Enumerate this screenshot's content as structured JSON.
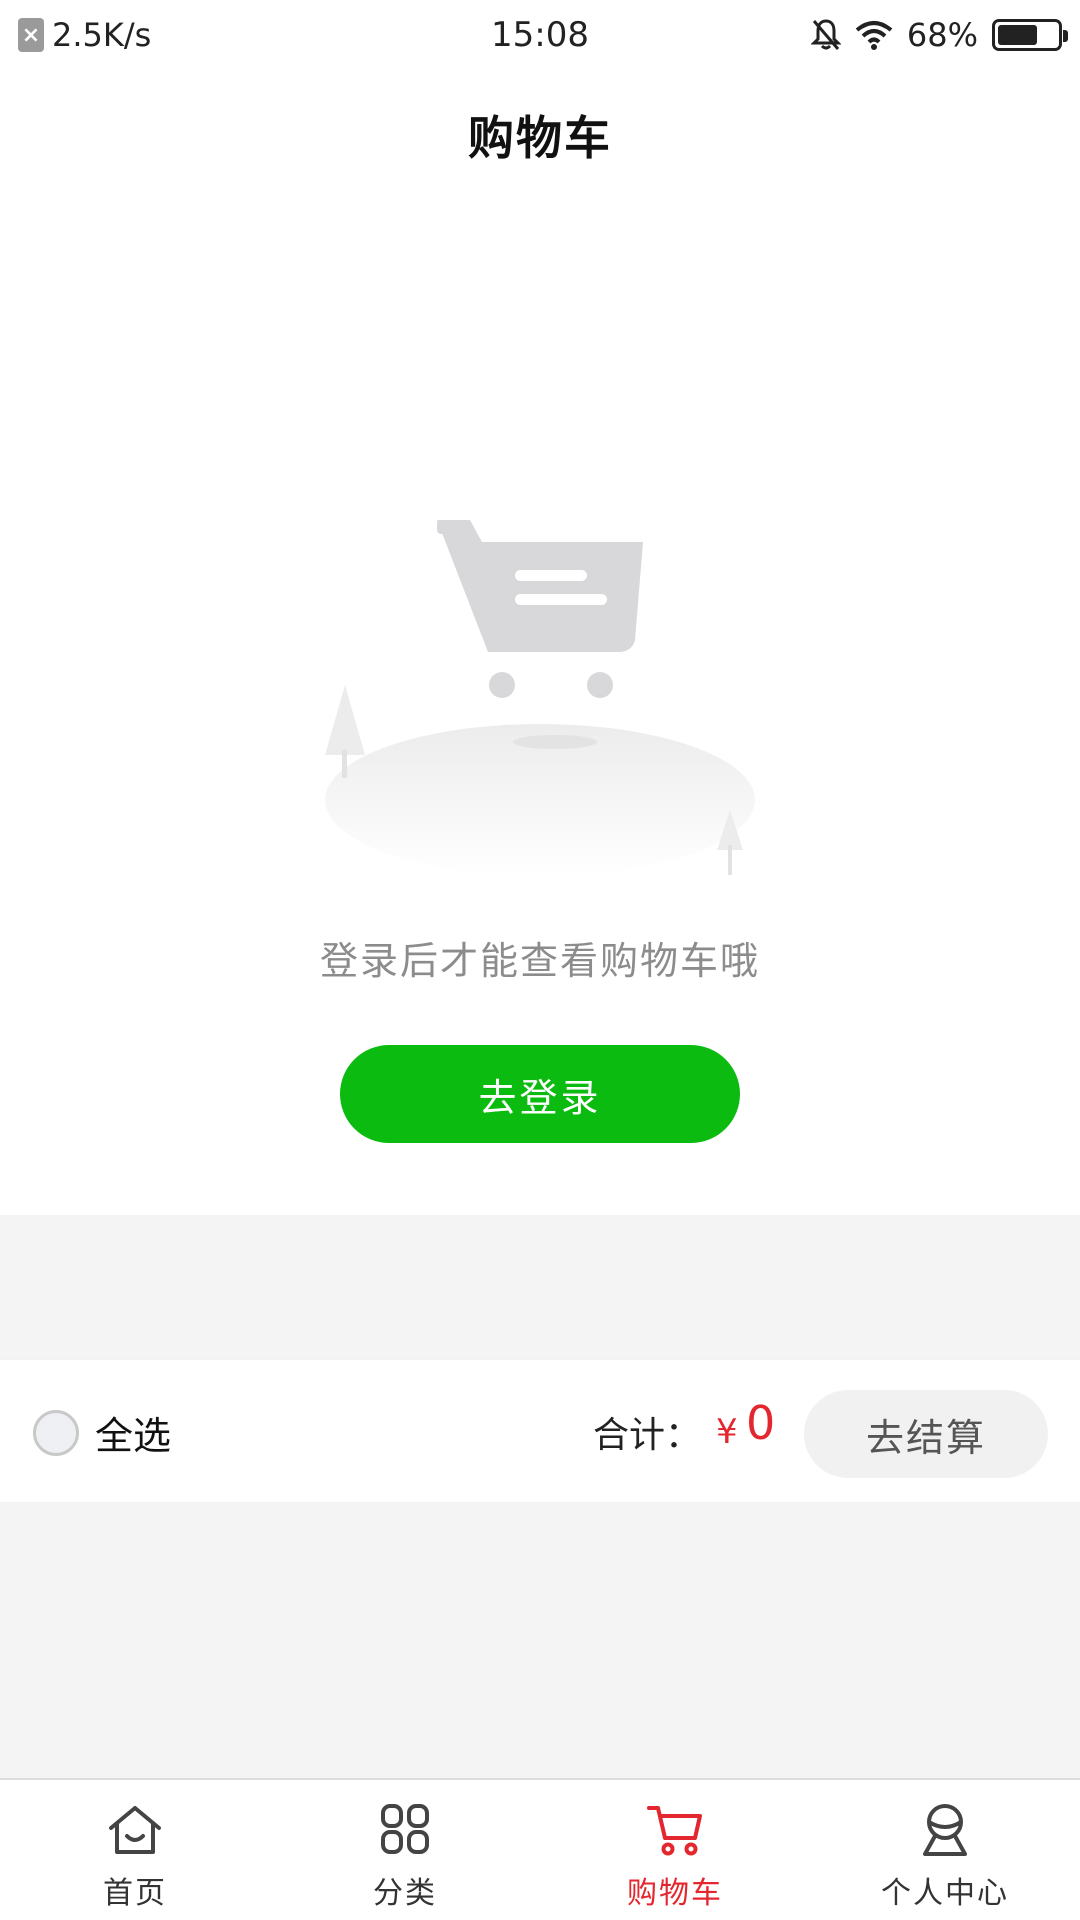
{
  "status_bar": {
    "speed": "2.5K/s",
    "time": "15:08",
    "battery": "68%",
    "icons": [
      "notification-blocked-icon",
      "no-sim-icon",
      "bell-off-icon",
      "wifi-icon",
      "battery-icon"
    ],
    "battery_level": 0.68
  },
  "header": {
    "title": "购物车"
  },
  "empty_state": {
    "illustration": "empty-cart-icon",
    "message": "登录后才能查看购物车哦",
    "login_button": "去登录"
  },
  "checkout": {
    "select_all_label": "全选",
    "total_label": "合计：",
    "currency": "¥",
    "total_value": "0",
    "settle_button": "去结算"
  },
  "tabbar": {
    "items": [
      {
        "label": "首页",
        "icon": "home-icon",
        "active": false
      },
      {
        "label": "分类",
        "icon": "category-grid-icon",
        "active": false
      },
      {
        "label": "购物车",
        "icon": "cart-icon",
        "active": true
      },
      {
        "label": "个人中心",
        "icon": "user-icon",
        "active": false
      }
    ]
  },
  "colors": {
    "accent_green": "#0bbb0f",
    "accent_red": "#e4262f",
    "background_grey": "#f4f4f4"
  }
}
